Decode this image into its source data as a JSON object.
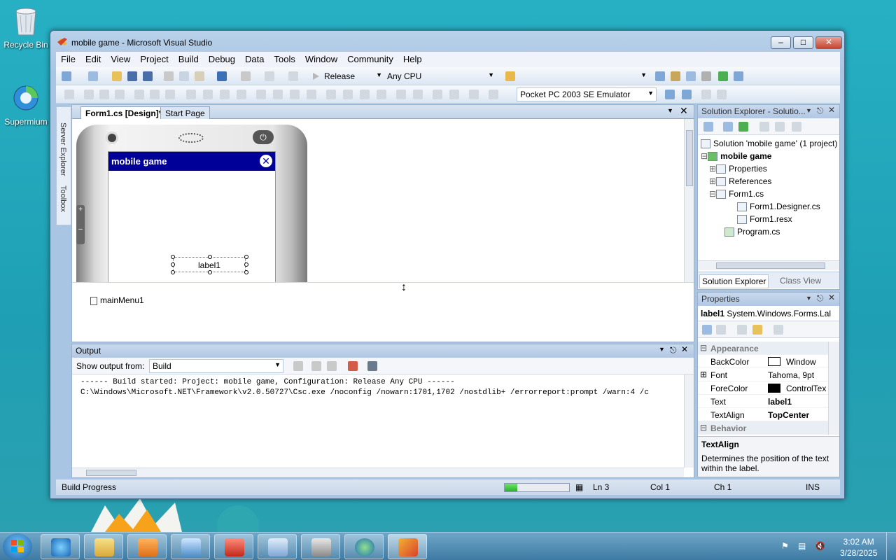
{
  "desktop": {
    "icons": [
      {
        "label": "Recycle Bin",
        "icon": "recycle-bin-icon"
      },
      {
        "label": "Supermium",
        "icon": "browser-icon"
      }
    ]
  },
  "window": {
    "title": "mobile game - Microsoft Visual Studio",
    "menu": [
      "File",
      "Edit",
      "View",
      "Project",
      "Build",
      "Debug",
      "Data",
      "Tools",
      "Window",
      "Community",
      "Help"
    ],
    "toolbar": {
      "config": "Release",
      "platform": "Any CPU",
      "find": "",
      "device": "Pocket PC 2003 SE Emulator"
    },
    "left_strip": [
      "Server Explorer",
      "Toolbox"
    ],
    "doc_tabs": [
      "Form1.cs [Design]*",
      "Start Page"
    ],
    "designer": {
      "form_title": "mobile game",
      "label": "label1",
      "tray_component": "mainMenu1"
    },
    "output": {
      "title": "Output",
      "show_from_label": "Show output from:",
      "show_from_value": "Build",
      "lines": [
        "------ Build started: Project: mobile game, Configuration: Release Any CPU ------",
        "C:\\Windows\\Microsoft.NET\\Framework\\v2.0.50727\\Csc.exe /noconfig /nowarn:1701,1702 /nostdlib+ /errorreport:prompt /warn:4 /c"
      ]
    },
    "solution_explorer": {
      "title": "Solution Explorer - Solutio...",
      "items": [
        {
          "label": "Solution 'mobile game' (1 project)",
          "bold": false
        },
        {
          "label": "mobile game",
          "bold": true
        },
        {
          "label": "Properties",
          "bold": false
        },
        {
          "label": "References",
          "bold": false
        },
        {
          "label": "Form1.cs",
          "bold": false
        },
        {
          "label": "Form1.Designer.cs",
          "bold": false
        },
        {
          "label": "Form1.resx",
          "bold": false
        },
        {
          "label": "Program.cs",
          "bold": false
        }
      ],
      "tabs": [
        "Solution Explorer",
        "Class View"
      ]
    },
    "properties": {
      "title": "Properties",
      "object": "label1",
      "object_type": "System.Windows.Forms.Lal",
      "categories": [
        "Appearance",
        "Behavior"
      ],
      "rows": [
        {
          "name": "BackColor",
          "value": "Window",
          "swatch": "#ffffff"
        },
        {
          "name": "Font",
          "value": "Tahoma, 9pt"
        },
        {
          "name": "ForeColor",
          "value": "ControlTex",
          "swatch": "#000000"
        },
        {
          "name": "Text",
          "value": "label1",
          "bold": true
        },
        {
          "name": "TextAlign",
          "value": "TopCenter",
          "bold": true
        }
      ],
      "desc_title": "TextAlign",
      "desc_text": "Determines the position of the text within the label."
    },
    "status": {
      "text": "Build Progress",
      "progress": 0.2,
      "ln": "Ln 3",
      "col": "Col 1",
      "ch": "Ch 1",
      "mode": "INS"
    }
  },
  "taskbar": {
    "apps": [
      "internet-explorer-icon",
      "file-explorer-icon",
      "media-player-icon",
      "computer-icon",
      "toolbox-icon",
      "network-icon",
      "tools-icon",
      "browser-icon",
      "visual-studio-icon"
    ],
    "time": "3:02 AM",
    "date": "3/28/2025"
  },
  "colors": {
    "form_title_bg": "#000099",
    "progress": "#2bb12a",
    "desktop": "#27b0c4"
  }
}
